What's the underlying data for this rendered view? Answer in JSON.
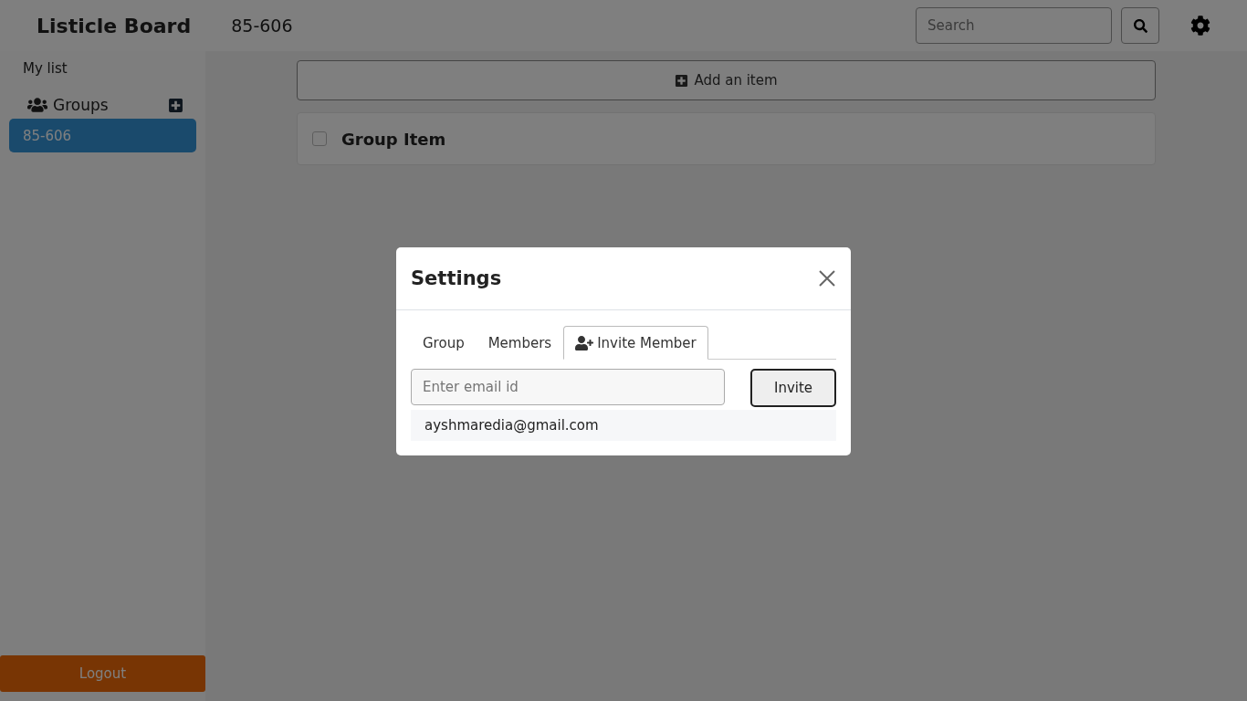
{
  "app": {
    "title": "Listicle Board",
    "current_group": "85-606"
  },
  "search": {
    "placeholder": "Search"
  },
  "sidebar": {
    "my_list": "My list",
    "groups_label": "Groups",
    "groups": [
      {
        "label": "85-606",
        "selected": true
      }
    ],
    "logout": "Logout"
  },
  "main": {
    "add_item": "Add an item",
    "items": [
      {
        "label": "Group Item",
        "checked": false
      }
    ]
  },
  "modal": {
    "title": "Settings",
    "tabs": [
      {
        "label": "Group",
        "kind": "plain",
        "selected": false
      },
      {
        "label": "Members",
        "kind": "plain",
        "selected": false
      },
      {
        "label": "Invite Member",
        "kind": "invite",
        "selected": true
      }
    ],
    "email": {
      "placeholder": "Enter email id"
    },
    "invite": "Invite",
    "suggestions": [
      "ayshmaredia@gmail.com"
    ]
  }
}
